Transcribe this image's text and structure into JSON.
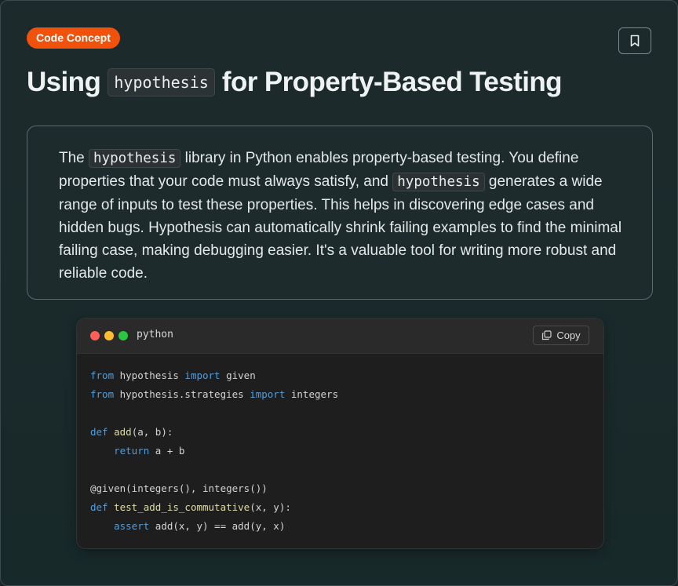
{
  "badge": "Code Concept",
  "title": {
    "prefix": "Using",
    "code": "hypothesis",
    "suffix": "for Property-Based Testing"
  },
  "description": {
    "p1": "The",
    "code1": "hypothesis",
    "p2": "library in Python enables property-based testing. You define properties that your code must always satisfy, and",
    "code2": "hypothesis",
    "p3": "generates a wide range of inputs to test these properties. This helps in discovering edge cases and hidden bugs. Hypothesis can automatically shrink failing examples to find the minimal failing case, making debugging easier. It's a valuable tool for writing more robust and reliable code."
  },
  "code_block": {
    "language": "python",
    "copy_label": "Copy",
    "lines": [
      "from hypothesis import given",
      "from hypothesis.strategies import integers",
      "",
      "def add(a, b):",
      "    return a + b",
      "",
      "@given(integers(), integers())",
      "def test_add_is_commutative(x, y):",
      "    assert add(x, y) == add(y, x)"
    ]
  },
  "colors": {
    "badge_bg": "#f0520c",
    "dot_red": "#ff5f57",
    "dot_yellow": "#febc2e",
    "dot_green": "#28c840",
    "keyword": "#569cd6",
    "function": "#dcdcaa"
  },
  "icons": {
    "bookmark": "bookmark-icon",
    "copy": "copy-icon"
  }
}
